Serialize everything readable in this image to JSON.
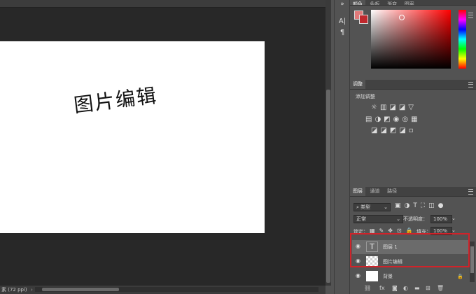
{
  "canvas": {
    "art_text": "图片编辑",
    "status_text": "素 (72 ppi)"
  },
  "toolstrip": {
    "icons": [
      "collapse-icon",
      "character-panel-icon",
      "paragraph-panel-icon"
    ],
    "labels": [
      "»",
      "A|",
      "¶"
    ]
  },
  "color_panel": {
    "tabs": [
      "颜色",
      "色板",
      "渐变",
      "图案"
    ],
    "foreground": "#e07a7a",
    "background": "#c0282d"
  },
  "adjustments": {
    "tab": "调整",
    "add_label": "添加调整"
  },
  "layers_panel": {
    "tabs": [
      "图层",
      "通道",
      "路径"
    ],
    "filter_kind": "类型",
    "blend_mode": "正常",
    "opacity_label": "不透明度：",
    "opacity_value": "100%",
    "lock_label": "锁定：",
    "fill_label": "填充：",
    "fill_value": "100%",
    "layers": [
      {
        "name": "图层 1",
        "thumb": "T",
        "selected": true
      },
      {
        "name": "图片编辑",
        "thumb": "checker",
        "selected": false
      },
      {
        "name": "背景",
        "thumb": "white",
        "selected": false
      }
    ],
    "footer_fx": "fx"
  },
  "colors": {
    "highlight": "#d0232a",
    "selected_row": "#6b6b6b"
  }
}
